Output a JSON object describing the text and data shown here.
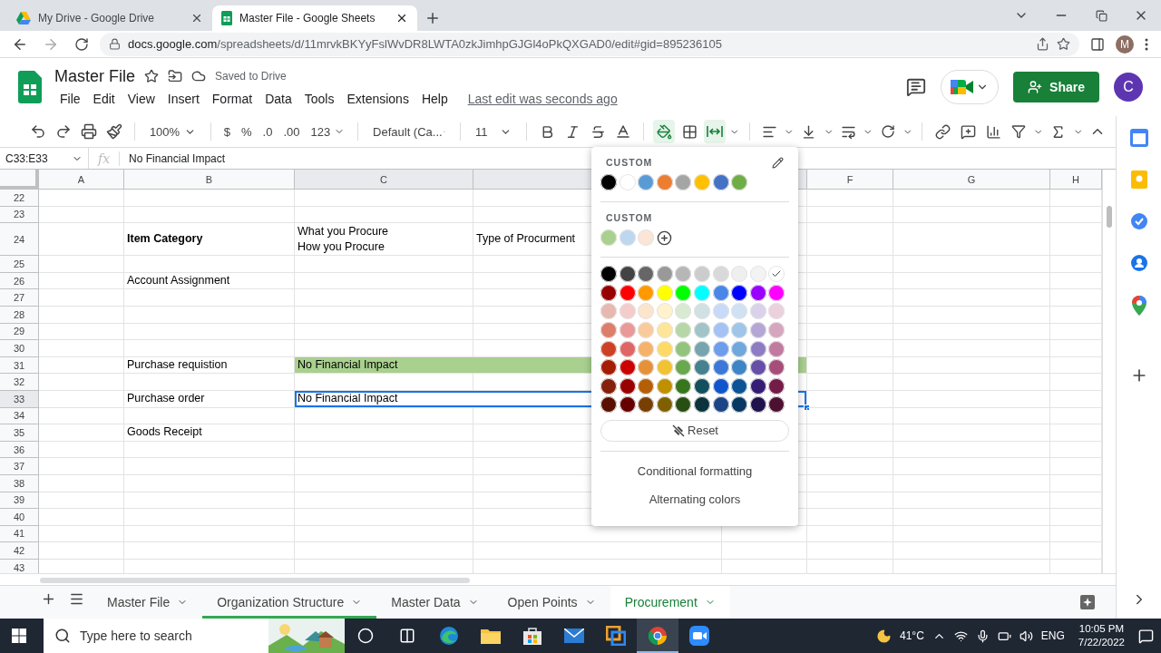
{
  "browser": {
    "tabs": [
      {
        "kind": "drive",
        "title": "My Drive - Google Drive",
        "selected": false
      },
      {
        "kind": "sheets",
        "title": "Master File - Google Sheets",
        "selected": true
      }
    ],
    "address": {
      "host": "docs.google.com",
      "path": "/spreadsheets/d/11mrvkBKYyFslWvDR8LWTA0zkJimhpGJGl4oPkQXGAD0/edit#gid=895236105"
    },
    "profile_initial": "M"
  },
  "document": {
    "title": "Master File",
    "starred": false,
    "save_status": "Saved to Drive",
    "menus": [
      "File",
      "Edit",
      "View",
      "Insert",
      "Format",
      "Data",
      "Tools",
      "Extensions",
      "Help"
    ],
    "last_edit": "Last edit was seconds ago",
    "share_label": "Share",
    "account_initial": "C"
  },
  "toolbar": {
    "zoom": "100%",
    "currency": "$",
    "percent": "%",
    "decrease_decimals": ".0",
    "increase_decimals": ".00",
    "number_format": "123",
    "font": "Default (Ca...",
    "font_size": "11",
    "fill_menu_open": true,
    "merge_on": true
  },
  "formula_bar": {
    "name_box": "C33:E33",
    "fx": "fx",
    "value": "No Financial Impact"
  },
  "columns": [
    {
      "label": "A",
      "selected": false
    },
    {
      "label": "B",
      "selected": false
    },
    {
      "label": "C",
      "selected": true
    },
    {
      "selected": true
    },
    {
      "selected": true
    },
    {
      "label": "F",
      "selected": false
    },
    {
      "label": "G",
      "selected": false
    },
    {
      "label": "H",
      "selected": false
    }
  ],
  "rows": [
    {
      "number": "22",
      "tall": false,
      "selected": false
    },
    {
      "number": "23",
      "tall": false,
      "selected": false
    },
    {
      "number": "24",
      "tall": true,
      "selected": false,
      "cells": [
        null,
        {
          "text": "Item Category",
          "bold": true,
          "selected": false
        },
        {
          "text": "What you Procure\nHow you Procure",
          "bold": false,
          "selected": false
        },
        {
          "text": "Type of Procurment",
          "bold": false,
          "selected": false
        },
        null,
        null,
        null,
        null
      ]
    },
    {
      "number": "25",
      "tall": false,
      "selected": false
    },
    {
      "number": "26",
      "tall": false,
      "selected": false,
      "cells": [
        null,
        {
          "text": "Account Assignment",
          "bold": false,
          "selected": false
        },
        null,
        null,
        null,
        null,
        null,
        null
      ]
    },
    {
      "number": "27",
      "tall": false,
      "selected": false
    },
    {
      "number": "28",
      "tall": false,
      "selected": false
    },
    {
      "number": "29",
      "tall": false,
      "selected": false
    },
    {
      "number": "30",
      "tall": false,
      "selected": false
    },
    {
      "number": "31",
      "tall": false,
      "selected": false,
      "cells": [
        null,
        {
          "text": "Purchase requistion",
          "bold": false,
          "selected": false
        },
        {
          "text": "No Financial Impact",
          "bold": false,
          "selected": false,
          "color": "#a9d08e"
        },
        {
          "covered": true
        },
        {
          "covered": true
        },
        null,
        null,
        null
      ]
    },
    {
      "number": "32",
      "tall": false,
      "selected": false
    },
    {
      "number": "33",
      "tall": false,
      "selected": true,
      "cells": [
        null,
        {
          "text": "Purchase order",
          "bold": false,
          "selected": false
        },
        {
          "text": "No Financial Impact",
          "bold": false,
          "selected": true
        },
        {
          "covered": true
        },
        {
          "covered": true
        },
        null,
        null,
        null
      ]
    },
    {
      "number": "34",
      "tall": false,
      "selected": false
    },
    {
      "number": "35",
      "tall": false,
      "selected": false,
      "cells": [
        null,
        {
          "text": "Goods Receipt",
          "bold": false,
          "selected": false
        },
        null,
        null,
        null,
        null,
        null,
        null
      ]
    },
    {
      "number": "36",
      "tall": false,
      "selected": false
    },
    {
      "number": "37",
      "tall": false,
      "selected": false
    },
    {
      "number": "38",
      "tall": false,
      "selected": false
    },
    {
      "number": "39",
      "tall": false,
      "selected": false
    },
    {
      "number": "40",
      "tall": false,
      "selected": false
    },
    {
      "number": "41",
      "tall": false,
      "selected": false
    },
    {
      "number": "42",
      "tall": false,
      "selected": false
    },
    {
      "number": "43",
      "tall": false,
      "selected": false
    }
  ],
  "color_menu": {
    "theme_label": "CUSTOM",
    "theme_colors": [
      {
        "color": "#000000",
        "selected": false
      },
      {
        "color": "#ffffff",
        "selected": false
      },
      {
        "color": "#5b9bd5",
        "selected": false
      },
      {
        "color": "#ed7d31",
        "selected": false
      },
      {
        "color": "#a5a5a5",
        "selected": false
      },
      {
        "color": "#ffc000",
        "selected": false
      },
      {
        "color": "#4472c4",
        "selected": false
      },
      {
        "color": "#70ad47",
        "selected": false
      }
    ],
    "custom_label": "CUSTOM",
    "custom_colors": [
      {
        "color": "#a9d08e",
        "selected": false
      },
      {
        "color": "#bdd7ee",
        "selected": false
      },
      {
        "color": "#fbe5d6",
        "selected": false
      }
    ],
    "palette": [
      [
        {
          "color": "#000000",
          "selected": false
        },
        {
          "color": "#434343",
          "selected": false
        },
        {
          "color": "#666666",
          "selected": false
        },
        {
          "color": "#999999",
          "selected": false
        },
        {
          "color": "#b7b7b7",
          "selected": false
        },
        {
          "color": "#cccccc",
          "selected": false
        },
        {
          "color": "#d9d9d9",
          "selected": false
        },
        {
          "color": "#efefef",
          "selected": false
        },
        {
          "color": "#f3f3f3",
          "selected": false
        },
        {
          "color": "#ffffff",
          "selected": true
        }
      ],
      [
        {
          "color": "#980000",
          "selected": false
        },
        {
          "color": "#ff0000",
          "selected": false
        },
        {
          "color": "#ff9900",
          "selected": false
        },
        {
          "color": "#ffff00",
          "selected": false
        },
        {
          "color": "#00ff00",
          "selected": false
        },
        {
          "color": "#00ffff",
          "selected": false
        },
        {
          "color": "#4a86e8",
          "selected": false
        },
        {
          "color": "#0000ff",
          "selected": false
        },
        {
          "color": "#9900ff",
          "selected": false
        },
        {
          "color": "#ff00ff",
          "selected": false
        }
      ],
      [
        {
          "color": "#e6b8af",
          "selected": false
        },
        {
          "color": "#f4cccc",
          "selected": false
        },
        {
          "color": "#fce5cd",
          "selected": false
        },
        {
          "color": "#fff2cc",
          "selected": false
        },
        {
          "color": "#d9ead3",
          "selected": false
        },
        {
          "color": "#d0e0e3",
          "selected": false
        },
        {
          "color": "#c9daf8",
          "selected": false
        },
        {
          "color": "#cfe2f3",
          "selected": false
        },
        {
          "color": "#d9d2e9",
          "selected": false
        },
        {
          "color": "#ead1dc",
          "selected": false
        }
      ],
      [
        {
          "color": "#dd7e6b",
          "selected": false
        },
        {
          "color": "#ea9999",
          "selected": false
        },
        {
          "color": "#f9cb9c",
          "selected": false
        },
        {
          "color": "#ffe599",
          "selected": false
        },
        {
          "color": "#b6d7a8",
          "selected": false
        },
        {
          "color": "#a2c4c9",
          "selected": false
        },
        {
          "color": "#a4c2f4",
          "selected": false
        },
        {
          "color": "#9fc5e8",
          "selected": false
        },
        {
          "color": "#b4a7d6",
          "selected": false
        },
        {
          "color": "#d5a6bd",
          "selected": false
        }
      ],
      [
        {
          "color": "#cc4125",
          "selected": false
        },
        {
          "color": "#e06666",
          "selected": false
        },
        {
          "color": "#f6b26b",
          "selected": false
        },
        {
          "color": "#ffd966",
          "selected": false
        },
        {
          "color": "#93c47d",
          "selected": false
        },
        {
          "color": "#76a5af",
          "selected": false
        },
        {
          "color": "#6d9eeb",
          "selected": false
        },
        {
          "color": "#6fa8dc",
          "selected": false
        },
        {
          "color": "#8e7cc3",
          "selected": false
        },
        {
          "color": "#c27ba0",
          "selected": false
        }
      ],
      [
        {
          "color": "#a61c00",
          "selected": false
        },
        {
          "color": "#cc0000",
          "selected": false
        },
        {
          "color": "#e69138",
          "selected": false
        },
        {
          "color": "#f1c232",
          "selected": false
        },
        {
          "color": "#6aa84f",
          "selected": false
        },
        {
          "color": "#45818e",
          "selected": false
        },
        {
          "color": "#3c78d8",
          "selected": false
        },
        {
          "color": "#3d85c6",
          "selected": false
        },
        {
          "color": "#674ea7",
          "selected": false
        },
        {
          "color": "#a64d79",
          "selected": false
        }
      ],
      [
        {
          "color": "#85200c",
          "selected": false
        },
        {
          "color": "#990000",
          "selected": false
        },
        {
          "color": "#b45f06",
          "selected": false
        },
        {
          "color": "#bf9000",
          "selected": false
        },
        {
          "color": "#38761d",
          "selected": false
        },
        {
          "color": "#134f5c",
          "selected": false
        },
        {
          "color": "#1155cc",
          "selected": false
        },
        {
          "color": "#0b5394",
          "selected": false
        },
        {
          "color": "#351c75",
          "selected": false
        },
        {
          "color": "#741b47",
          "selected": false
        }
      ],
      [
        {
          "color": "#5b0f00",
          "selected": false
        },
        {
          "color": "#660000",
          "selected": false
        },
        {
          "color": "#783f04",
          "selected": false
        },
        {
          "color": "#7f6000",
          "selected": false
        },
        {
          "color": "#274e13",
          "selected": false
        },
        {
          "color": "#0c343d",
          "selected": false
        },
        {
          "color": "#1c4587",
          "selected": false
        },
        {
          "color": "#073763",
          "selected": false
        },
        {
          "color": "#20124d",
          "selected": false
        },
        {
          "color": "#4c1130",
          "selected": false
        }
      ]
    ],
    "reset": "Reset",
    "options": [
      "Conditional formatting",
      "Alternating colors"
    ]
  },
  "sheet_tabs": [
    {
      "title": "Master File",
      "selected": false
    },
    {
      "title": "Organization Structure",
      "selected": false,
      "color": "#34a853"
    },
    {
      "title": "Master Data",
      "selected": false
    },
    {
      "title": "Open Points",
      "selected": false
    },
    {
      "title": "Procurement",
      "selected": true
    }
  ],
  "taskbar": {
    "search_placeholder": "Type here to search",
    "apps": [
      {
        "kind": "cortana",
        "selected": false
      },
      {
        "kind": "taskview",
        "selected": false
      },
      {
        "kind": "edge",
        "selected": false
      },
      {
        "kind": "files",
        "selected": false
      },
      {
        "kind": "store",
        "selected": false
      },
      {
        "kind": "mail",
        "selected": false
      },
      {
        "kind": "app",
        "selected": false
      },
      {
        "kind": "chrome",
        "selected": true
      },
      {
        "kind": "zoom",
        "selected": false
      }
    ],
    "weather": "41°C",
    "language": "ENG",
    "time": "10:05 PM",
    "date": "7/22/2022"
  }
}
